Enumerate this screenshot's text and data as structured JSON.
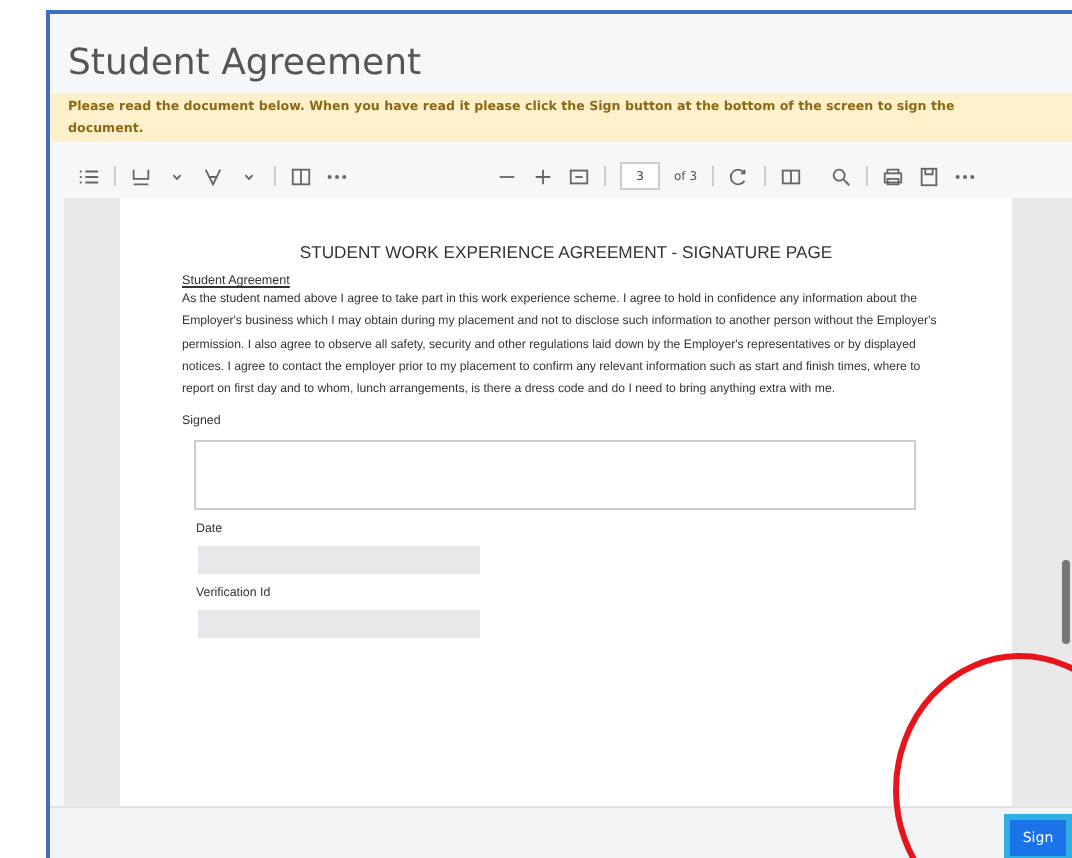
{
  "title": "Student Agreement",
  "notice": "Please read the document below. When you have read it please click the Sign button at the bottom of the screen to sign the document.",
  "toolbar": {
    "page_number": "3",
    "page_count": "of 3"
  },
  "document": {
    "heading": "STUDENT WORK EXPERIENCE AGREEMENT - SIGNATURE PAGE",
    "section_title": "Student Agreement",
    "paragraph": "As the student named above I agree to take part in this work experience scheme. I agree to hold in confidence any information about the Employer's business which I may obtain during my placement and not to disclose such information to another person without the Employer's permission. I also agree to observe all safety, security and other regulations laid down by the Employer's representatives or by displayed notices. I agree to contact the employer prior to my placement to confirm any relevant information such as start and finish times, where to report on first day and to whom, lunch arrangements, is there a dress code and do I need to bring anything extra with me.",
    "fields": [
      {
        "label": "Signed",
        "kind": "signature"
      },
      {
        "label": "Date",
        "kind": "readonly"
      },
      {
        "label": "Verification Id",
        "kind": "readonly"
      }
    ]
  },
  "sign_button": {
    "label": "Sign",
    "focused": true
  },
  "annotations": [
    {
      "kind": "ellipse"
    }
  ]
}
